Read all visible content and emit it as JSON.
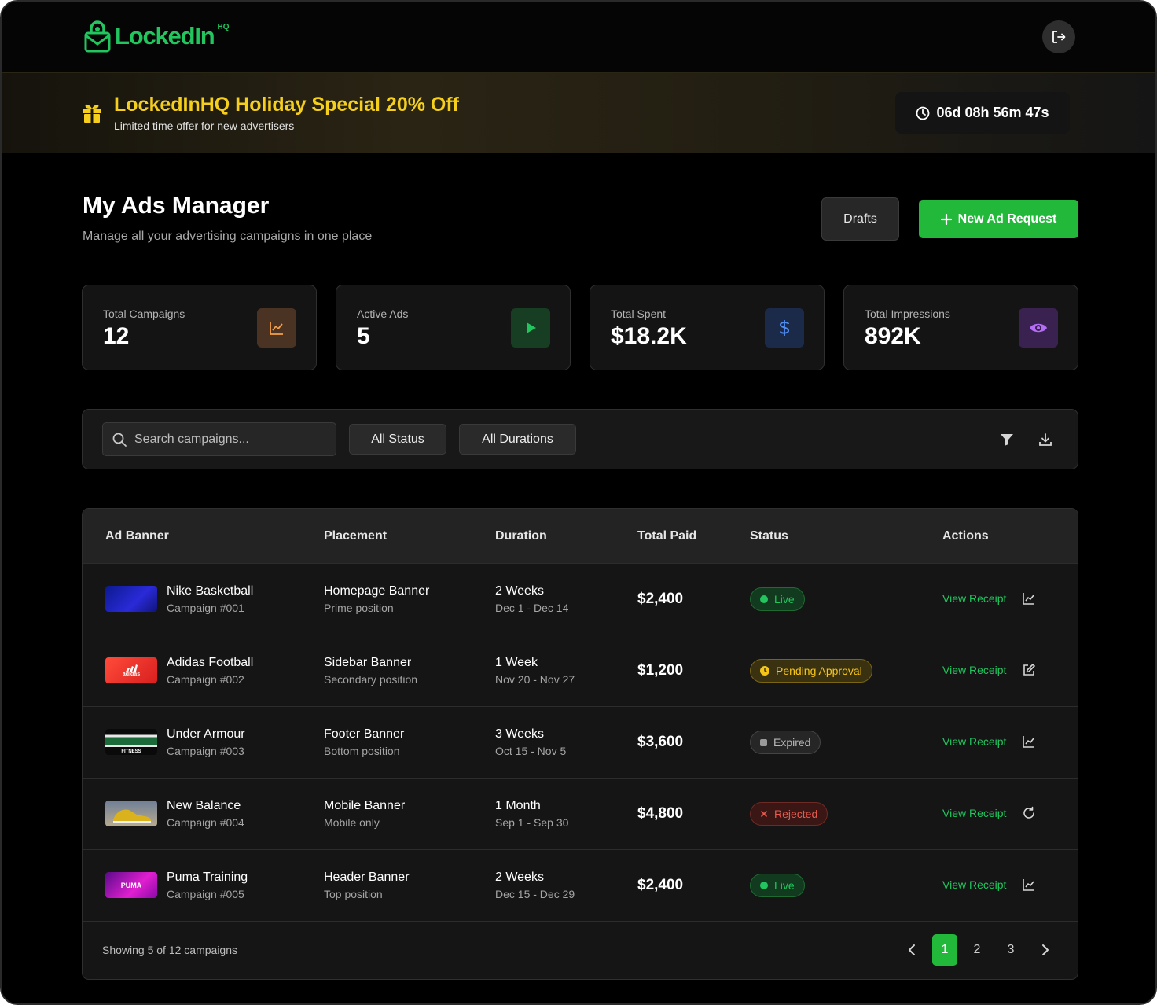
{
  "app": {
    "logo_text": "LockedIn",
    "logo_superscript": "HQ"
  },
  "icons": {
    "logo": "padlock-envelope-icon",
    "logout": "logout-icon",
    "gift": "gift-icon",
    "clock": "clock-icon",
    "plus": "plus-icon",
    "search": "search-icon",
    "filter": "filter-icon",
    "download": "download-icon"
  },
  "promo": {
    "title": "LockedInHQ Holiday Special 20% Off",
    "subtitle": "Limited time offer for new advertisers",
    "countdown": "06d 08h 56m 47s"
  },
  "page": {
    "title": "My Ads Manager",
    "subtitle": "Manage all your advertising campaigns in one place",
    "drafts_label": "Drafts",
    "new_request_label": "New Ad Request"
  },
  "stats": [
    {
      "label": "Total Campaigns",
      "value": "12",
      "icon": "line-chart-icon",
      "color": "#f5a04a"
    },
    {
      "label": "Active Ads",
      "value": "5",
      "icon": "play-icon",
      "color": "#22c55e"
    },
    {
      "label": "Total Spent",
      "value": "$18.2K",
      "icon": "dollar-icon",
      "color": "#4f8cf0"
    },
    {
      "label": "Total Impressions",
      "value": "892K",
      "icon": "eye-icon",
      "color": "#b46ef5"
    }
  ],
  "filters": {
    "search_placeholder": "Search campaigns...",
    "status_select": "All Status",
    "duration_select": "All Durations"
  },
  "table": {
    "headers": [
      "Ad Banner",
      "Placement",
      "Duration",
      "Total Paid",
      "Status",
      "Actions"
    ],
    "rows": [
      {
        "name": "Nike Basketball",
        "campaign": "Campaign #001",
        "placement": "Homepage Banner",
        "placement_sub": "Prime position",
        "duration": "2 Weeks",
        "dates": "Dec 1 - Dec 14",
        "paid": "$2,400",
        "status": "Live",
        "action": "View Receipt",
        "action_icon": "analytics-icon",
        "thumb": "nike-thumbnail"
      },
      {
        "name": "Adidas Football",
        "campaign": "Campaign #002",
        "placement": "Sidebar Banner",
        "placement_sub": "Secondary position",
        "duration": "1 Week",
        "dates": "Nov 20 - Nov 27",
        "paid": "$1,200",
        "status": "Pending Approval",
        "action": "View Receipt",
        "action_icon": "edit-icon",
        "thumb": "adidas-thumbnail",
        "thumb_text": "adidas"
      },
      {
        "name": "Under Armour",
        "campaign": "Campaign #003",
        "placement": "Footer Banner",
        "placement_sub": "Bottom position",
        "duration": "3 Weeks",
        "dates": "Oct 15 - Nov 5",
        "paid": "$3,600",
        "status": "Expired",
        "action": "View Receipt",
        "action_icon": "analytics-icon",
        "thumb": "fitness-thumbnail",
        "thumb_text": "FITNESS"
      },
      {
        "name": "New Balance",
        "campaign": "Campaign #004",
        "placement": "Mobile Banner",
        "placement_sub": "Mobile only",
        "duration": "1 Month",
        "dates": "Sep 1 - Sep 30",
        "paid": "$4,800",
        "status": "Rejected",
        "action": "View Receipt",
        "action_icon": "refresh-icon",
        "thumb": "sneaker-thumbnail"
      },
      {
        "name": "Puma Training",
        "campaign": "Campaign #005",
        "placement": "Header Banner",
        "placement_sub": "Top position",
        "duration": "2 Weeks",
        "dates": "Dec 15 - Dec 29",
        "paid": "$2,400",
        "status": "Live",
        "action": "View Receipt",
        "action_icon": "analytics-icon",
        "thumb": "puma-thumbnail",
        "thumb_text": "PUMA"
      }
    ]
  },
  "status_colors": {
    "Live": "#22c55e",
    "Pending Approval": "#f5c518",
    "Expired": "#9a9a9a",
    "Rejected": "#e85a4f"
  },
  "pagination": {
    "summary": "Showing 5 of 12 campaigns",
    "pages": [
      "1",
      "2",
      "3"
    ],
    "current": "1"
  }
}
